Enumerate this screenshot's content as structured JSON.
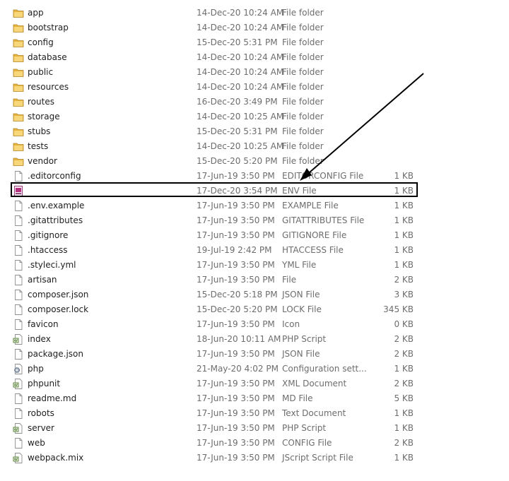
{
  "files": [
    {
      "name": "app",
      "date": "14-Dec-20 10:24 AM",
      "type": "File folder",
      "size": "",
      "icon": "folder-icon"
    },
    {
      "name": "bootstrap",
      "date": "14-Dec-20 10:24 AM",
      "type": "File folder",
      "size": "",
      "icon": "folder-icon"
    },
    {
      "name": "config",
      "date": "15-Dec-20 5:31 PM",
      "type": "File folder",
      "size": "",
      "icon": "folder-icon"
    },
    {
      "name": "database",
      "date": "14-Dec-20 10:24 AM",
      "type": "File folder",
      "size": "",
      "icon": "folder-icon"
    },
    {
      "name": "public",
      "date": "14-Dec-20 10:24 AM",
      "type": "File folder",
      "size": "",
      "icon": "folder-icon"
    },
    {
      "name": "resources",
      "date": "14-Dec-20 10:24 AM",
      "type": "File folder",
      "size": "",
      "icon": "folder-icon"
    },
    {
      "name": "routes",
      "date": "16-Dec-20 3:49 PM",
      "type": "File folder",
      "size": "",
      "icon": "folder-icon"
    },
    {
      "name": "storage",
      "date": "14-Dec-20 10:25 AM",
      "type": "File folder",
      "size": "",
      "icon": "folder-icon"
    },
    {
      "name": "stubs",
      "date": "15-Dec-20 5:31 PM",
      "type": "File folder",
      "size": "",
      "icon": "folder-icon"
    },
    {
      "name": "tests",
      "date": "14-Dec-20 10:25 AM",
      "type": "File folder",
      "size": "",
      "icon": "folder-icon"
    },
    {
      "name": "vendor",
      "date": "15-Dec-20 5:20 PM",
      "type": "File folder",
      "size": "",
      "icon": "folder-icon"
    },
    {
      "name": ".editorconfig",
      "date": "17-Jun-19 3:50 PM",
      "type": "EDITORCONFIG File",
      "size": "1 KB",
      "icon": "document-icon"
    },
    {
      "name": "",
      "date": "17-Dec-20 3:54 PM",
      "type": "ENV File",
      "size": "1 KB",
      "icon": "env-file-icon"
    },
    {
      "name": ".env.example",
      "date": "17-Jun-19 3:50 PM",
      "type": "EXAMPLE File",
      "size": "1 KB",
      "icon": "document-icon"
    },
    {
      "name": ".gitattributes",
      "date": "17-Jun-19 3:50 PM",
      "type": "GITATTRIBUTES File",
      "size": "1 KB",
      "icon": "document-icon"
    },
    {
      "name": ".gitignore",
      "date": "17-Jun-19 3:50 PM",
      "type": "GITIGNORE File",
      "size": "1 KB",
      "icon": "document-icon"
    },
    {
      "name": ".htaccess",
      "date": "19-Jul-19 2:42 PM",
      "type": "HTACCESS File",
      "size": "1 KB",
      "icon": "document-icon"
    },
    {
      "name": ".styleci.yml",
      "date": "17-Jun-19 3:50 PM",
      "type": "YML File",
      "size": "1 KB",
      "icon": "document-icon"
    },
    {
      "name": "artisan",
      "date": "17-Jun-19 3:50 PM",
      "type": "File",
      "size": "2 KB",
      "icon": "document-icon"
    },
    {
      "name": "composer.json",
      "date": "15-Dec-20 5:18 PM",
      "type": "JSON File",
      "size": "3 KB",
      "icon": "document-icon"
    },
    {
      "name": "composer.lock",
      "date": "15-Dec-20 5:20 PM",
      "type": "LOCK File",
      "size": "345 KB",
      "icon": "document-icon"
    },
    {
      "name": "favicon",
      "date": "17-Jun-19 3:50 PM",
      "type": "Icon",
      "size": "0 KB",
      "icon": "document-icon"
    },
    {
      "name": "index",
      "date": "18-Jun-20 10:11 AM",
      "type": "PHP Script",
      "size": "2 KB",
      "icon": "script-icon"
    },
    {
      "name": "package.json",
      "date": "17-Jun-19 3:50 PM",
      "type": "JSON File",
      "size": "2 KB",
      "icon": "document-icon"
    },
    {
      "name": "php",
      "date": "21-May-20 4:02 PM",
      "type": "Configuration sett...",
      "size": "1 KB",
      "icon": "gear-file-icon"
    },
    {
      "name": "phpunit",
      "date": "17-Jun-19 3:50 PM",
      "type": "XML Document",
      "size": "2 KB",
      "icon": "script-icon"
    },
    {
      "name": "readme.md",
      "date": "17-Jun-19 3:50 PM",
      "type": "MD File",
      "size": "5 KB",
      "icon": "document-icon"
    },
    {
      "name": "robots",
      "date": "17-Jun-19 3:50 PM",
      "type": "Text Document",
      "size": "1 KB",
      "icon": "document-icon"
    },
    {
      "name": "server",
      "date": "17-Jun-19 3:50 PM",
      "type": "PHP Script",
      "size": "1 KB",
      "icon": "script-icon"
    },
    {
      "name": "web",
      "date": "17-Jun-19 3:50 PM",
      "type": "CONFIG File",
      "size": "2 KB",
      "icon": "document-icon"
    },
    {
      "name": "webpack.mix",
      "date": "17-Jun-19 3:50 PM",
      "type": "JScript Script File",
      "size": "1 KB",
      "icon": "script-icon"
    }
  ]
}
